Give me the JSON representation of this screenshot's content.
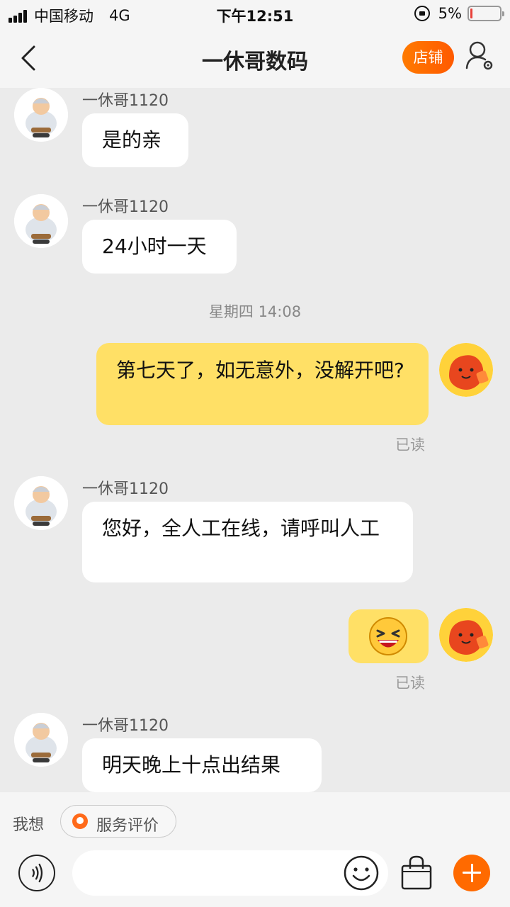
{
  "status_bar": {
    "carrier": "中国移动",
    "network": "4G",
    "time": "下午12:51",
    "battery": "5%",
    "battery_level": 0.05
  },
  "nav": {
    "title": "一休哥数码",
    "shop_label": "店铺",
    "back_icon": "chevron-left-icon",
    "profile_icon": "user-settings-icon"
  },
  "messages": [
    {
      "direction": "in",
      "sender": "一休哥1120",
      "text": "是的亲"
    },
    {
      "direction": "in",
      "sender": "一休哥1120",
      "text": "24小时一天"
    },
    {
      "type": "timestamp",
      "text": "星期四 14:08"
    },
    {
      "direction": "out",
      "text": "第七天了，如无意外，没解开吧?",
      "status": "已读"
    },
    {
      "direction": "in",
      "sender": "一休哥1120",
      "text": "您好，全人工在线，请呼叫人工"
    },
    {
      "direction": "out",
      "emoji": "laughing-face-emoji",
      "status": "已读"
    },
    {
      "direction": "in",
      "sender": "一休哥1120",
      "text": "明天晚上十点出结果"
    }
  ],
  "quick_bar": {
    "label": "我想",
    "chip_label": "服务评价"
  },
  "input_bar": {
    "placeholder": "",
    "voice_icon": "voice-icon",
    "emoji_icon": "smiley-icon",
    "bag_icon": "shopping-bag-icon",
    "plus_icon": "plus-icon"
  },
  "colors": {
    "accent": "#ff6a00",
    "outgoing_bubble": "#ffe066",
    "incoming_bubble": "#ffffff",
    "background": "#ebebeb"
  }
}
